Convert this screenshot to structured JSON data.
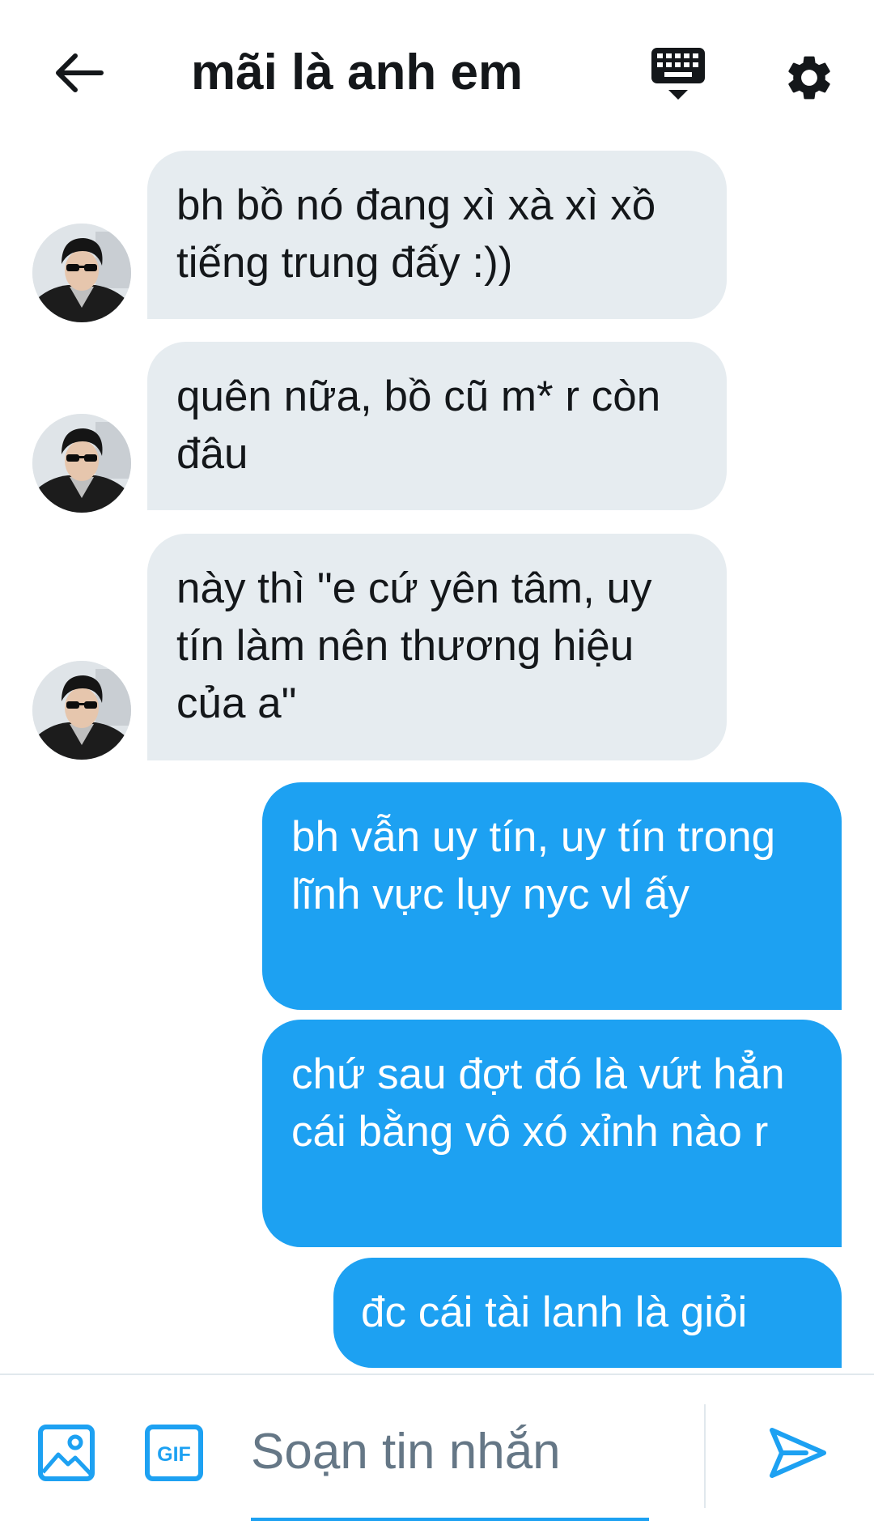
{
  "header": {
    "title": "mãi là anh em",
    "back_icon": "arrow-left-icon",
    "keyboard_icon": "keyboard-icon",
    "settings_icon": "gear-icon"
  },
  "messages": [
    {
      "direction": "in",
      "text": "bh bồ nó đang xì xà xì xồ tiếng trung đấy :))"
    },
    {
      "direction": "in",
      "text": "quên nữa, bồ cũ m* r còn đâu"
    },
    {
      "direction": "in",
      "text": "này thì \"e cứ yên tâm, uy tín làm nên thương hiệu của a\""
    },
    {
      "direction": "out",
      "text": "bh vẫn uy tín, uy tín trong lĩnh vực lụy nyc vl ấy"
    },
    {
      "direction": "out",
      "text": "chứ sau đợt đó là vứt hẳn cái bằng vô xó xỉnh nào r"
    },
    {
      "direction": "out",
      "text": "đc cái tài lanh là giỏi"
    }
  ],
  "composer": {
    "placeholder": "Soạn tin nhắn",
    "value": "",
    "media_icon": "image-icon",
    "gif_label": "GIF",
    "send_icon": "send-icon"
  },
  "colors": {
    "accent": "#1da1f2",
    "incoming_bubble": "#e6ecf0",
    "text": "#14171a",
    "placeholder": "#657786"
  }
}
